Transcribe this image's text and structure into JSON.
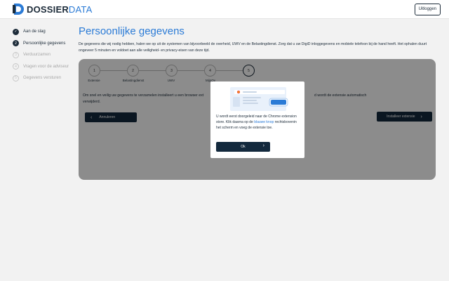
{
  "header": {
    "logo_bold": "DOSSIER",
    "logo_light": "DATA",
    "logout_label": "Uitloggen"
  },
  "sidebar": {
    "steps": [
      {
        "label": "Aan de slag",
        "state": "done",
        "icon": "check-icon",
        "marker": "✓"
      },
      {
        "label": "Persoonlijke gegevens",
        "state": "active",
        "marker": "2"
      },
      {
        "label": "Verduurzamen",
        "state": "todo",
        "marker": "3"
      },
      {
        "label": "Vragen voor de adviseur",
        "state": "todo",
        "marker": "4"
      },
      {
        "label": "Gegevens versturen",
        "state": "todo",
        "marker": "5"
      }
    ]
  },
  "main": {
    "title": "Persoonlijke gegevens",
    "intro": "De gegevens die wij nodig hebben, halen we op uit de systemen van bijvoorbeeld de overheid, UWV en de Belastingdienst. Zorg dat u uw DigiD inloggegevens en mobiele telefoon bij de hand heeft. Het ophalen duurt ongeveer 5 minuten en voldoet aan alle veiligheid- en privacy-eisen van deze tijd.",
    "progress": [
      {
        "num": "1",
        "label": "Extensie"
      },
      {
        "num": "2",
        "label": "Belastingdienst"
      },
      {
        "num": "3",
        "label": "UWV"
      },
      {
        "num": "4",
        "label": "MijnOv"
      },
      {
        "num": "5",
        "label": ""
      }
    ],
    "card_text_left": "Om snel en veilig uw gegevens te verzamelen installeert u een browser ext",
    "card_text_right": "d wordt de extensie automatisch",
    "card_text_line2": "verwijderd.",
    "back_label": "Annuleren",
    "install_label": "Installeer extensie"
  },
  "modal": {
    "text_before": "U wordt eerst doorgeleid naar de Chrome extension store. Klik daarna op de ",
    "text_highlight": "blauwe knop",
    "text_after": " rechtsbovenin het scherm en voeg de extensie toe.",
    "ok_label": "Ok"
  },
  "colors": {
    "accent_blue": "#2b7bd6",
    "navy": "#13293d",
    "highlight": "#2b7bd6"
  }
}
